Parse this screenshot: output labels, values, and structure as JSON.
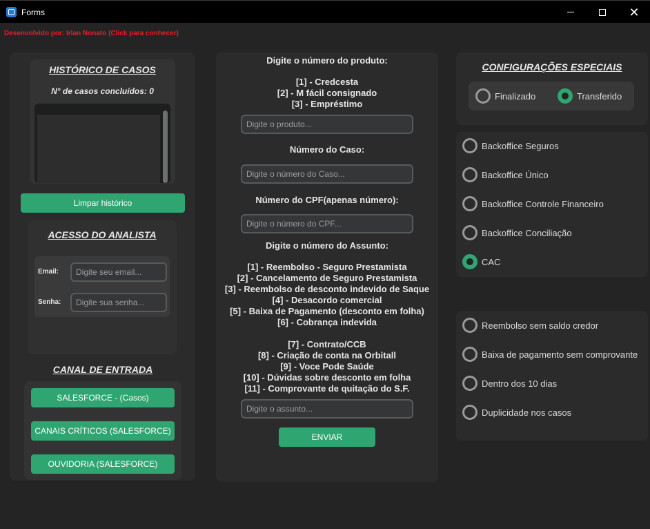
{
  "window": {
    "title": "Forms",
    "min_icon": "minimize-icon",
    "max_icon": "maximize-icon",
    "close_icon": "close-icon",
    "close_glyph": "✕"
  },
  "developer_link": "Desenvolvido por: Irlan Nonato (Click para conhecer)",
  "history": {
    "title": "HISTÓRICO DE CASOS",
    "count_label": "N° de casos concluídos: 0",
    "clear_button": "Limpar histórico"
  },
  "analyst": {
    "title": "ACESSO DO ANALISTA",
    "email_label": "Email:",
    "email_placeholder": "Digite seu email...",
    "password_label": "Senha:",
    "password_placeholder": "Digite sua senha..."
  },
  "channel": {
    "title": "CANAL DE ENTRADA",
    "buttons": [
      "SALESFORCE - (Casos)",
      "CANAIS CRÍTICOS (SALESFORCE)",
      "OUVIDORIA (SALESFORCE)"
    ]
  },
  "form": {
    "product_title": "Digite o número do produto:",
    "products": [
      "[1] - Credcesta",
      "[2] - M fácil consignado",
      "[3] - Empréstimo"
    ],
    "product_placeholder": "Digite o produto...",
    "case_title": "Número do Caso:",
    "case_placeholder": "Digite o número do Caso...",
    "cpf_title": "Número do CPF(apenas número):",
    "cpf_placeholder": "Digite o número do CPF...",
    "subject_title": "Digite o número do Assunto:",
    "subjects_a": [
      "[1] - Reembolso - Seguro Prestamista",
      "[2] - Cancelamento de Seguro Prestamista",
      "[3] - Reembolso de desconto indevido de Saque",
      "[4] - Desacordo comercial",
      "[5] - Baixa de Pagamento (desconto em folha)",
      "[6] - Cobrança indevida"
    ],
    "subjects_b": [
      "[7] - Contrato/CCB",
      "[8] - Criação de conta na Orbitall",
      "[9] - Voce Pode Saúde",
      "[10] - Dúvidas sobre desconto em folha",
      "[11] - Comprovante de quitação do S.F."
    ],
    "subject_placeholder": "Digite o assunto...",
    "submit_button": "ENVIAR"
  },
  "special": {
    "title": "CONFIGURAÇÕES ESPECIAIS",
    "status_options": [
      {
        "label": "Finalizado",
        "selected": false
      },
      {
        "label": "Transferido",
        "selected": true
      }
    ],
    "backoffice_options": [
      {
        "label": "Backoffice Seguros",
        "selected": false
      },
      {
        "label": "Backoffice Único",
        "selected": false
      },
      {
        "label": "Backoffice Controle Financeiro",
        "selected": false
      },
      {
        "label": "Backoffice Conciliação",
        "selected": false
      },
      {
        "label": "CAC",
        "selected": true
      }
    ],
    "case_options": [
      {
        "label": "Reembolso sem saldo credor",
        "selected": false
      },
      {
        "label": "Baixa de pagamento sem comprovante",
        "selected": false
      },
      {
        "label": "Dentro dos 10 dias",
        "selected": false
      },
      {
        "label": "Duplicidade nos casos",
        "selected": false
      }
    ]
  },
  "colors": {
    "accent": "#2fa572",
    "link": "#e0202a",
    "background": "#242424"
  }
}
